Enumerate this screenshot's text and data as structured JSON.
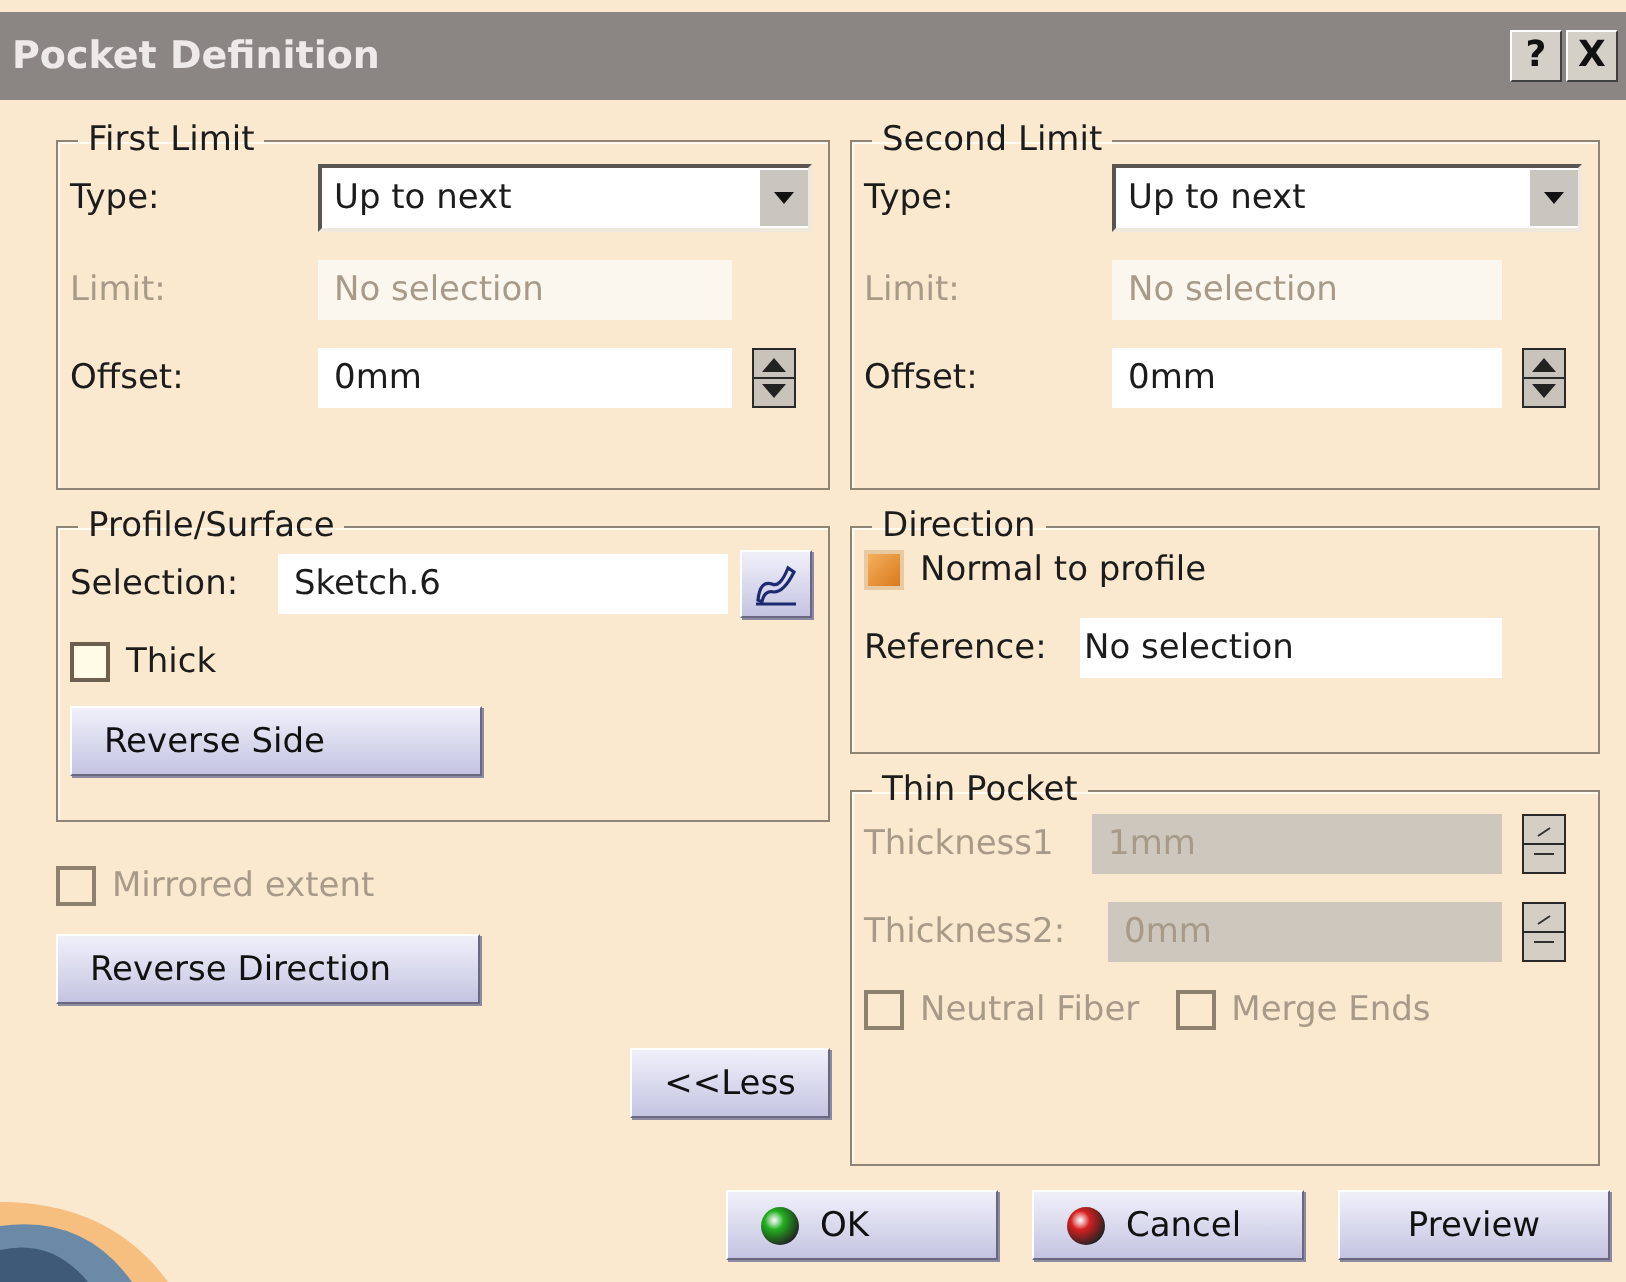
{
  "window": {
    "title": "Pocket Definition",
    "help": "?",
    "close": "X"
  },
  "first_limit": {
    "title": "First Limit",
    "type": {
      "label": "Type:",
      "value": "Up to next"
    },
    "limit": {
      "label": "Limit:",
      "value": "No selection",
      "disabled": true
    },
    "offset": {
      "label": "Offset:",
      "value": "0mm"
    }
  },
  "profile_surface": {
    "title": "Profile/Surface",
    "selection": {
      "label": "Selection:",
      "value": "Sketch.6"
    },
    "thick": {
      "label": "Thick",
      "checked": false
    },
    "reverse_side": "Reverse Side"
  },
  "mirrored_extent": {
    "label": "Mirrored extent",
    "checked": false,
    "disabled": true
  },
  "reverse_direction": "Reverse Direction",
  "less": "<<Less",
  "second_limit": {
    "title": "Second Limit",
    "type": {
      "label": "Type:",
      "value": "Up to next"
    },
    "limit": {
      "label": "Limit:",
      "value": "No selection",
      "disabled": true
    },
    "offset": {
      "label": "Offset:",
      "value": "0mm"
    }
  },
  "direction": {
    "title": "Direction",
    "normal_to_profile": {
      "label": "Normal to profile",
      "checked": true
    },
    "reference": {
      "label": "Reference:",
      "value": "No selection"
    }
  },
  "thin_pocket": {
    "title": "Thin Pocket",
    "disabled": true,
    "thickness1": {
      "label": "Thickness1",
      "value": "1mm"
    },
    "thickness2": {
      "label": "Thickness2:",
      "value": "0mm"
    },
    "options": [
      {
        "label": "Neutral Fiber",
        "checked": false
      },
      {
        "label": "Merge Ends",
        "checked": false
      }
    ]
  },
  "buttons": [
    {
      "label": "OK",
      "kind": "ok"
    },
    {
      "label": "Cancel",
      "kind": "cancel"
    },
    {
      "label": "Preview",
      "kind": "plain"
    }
  ]
}
